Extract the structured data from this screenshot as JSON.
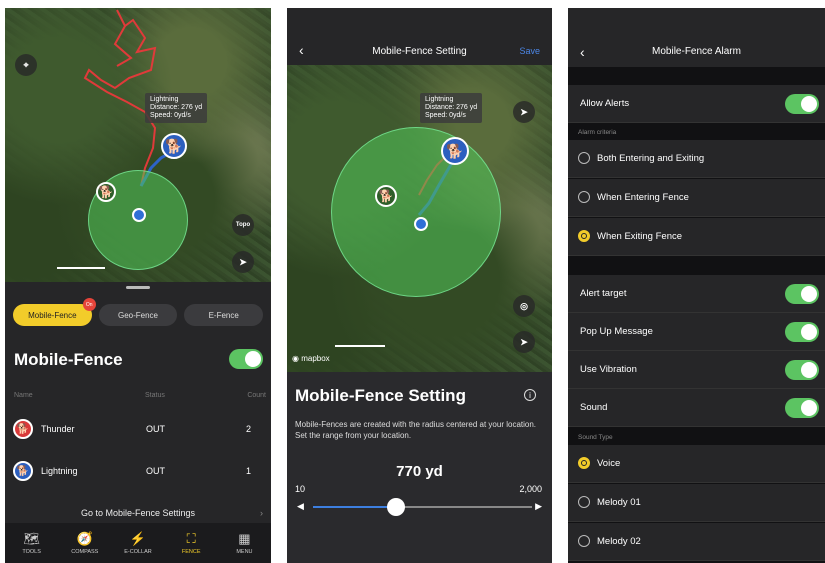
{
  "panel1": {
    "tooltip": {
      "name": "Lightning",
      "distance": "Distance: 276 yd",
      "speed": "Speed: 0yd/s"
    },
    "topo_label": "Topo",
    "segments": [
      {
        "label": "Mobile-Fence",
        "badge": "On",
        "active": true
      },
      {
        "label": "Geo-Fence",
        "active": false
      },
      {
        "label": "E-Fence",
        "active": false
      }
    ],
    "title": "Mobile-Fence",
    "toggle_on": true,
    "columns": {
      "name": "Name",
      "status": "Status",
      "count": "Count"
    },
    "rows": [
      {
        "name": "Thunder",
        "status": "OUT",
        "count": "2",
        "color": "#d93a3a"
      },
      {
        "name": "Lightning",
        "status": "OUT",
        "count": "1",
        "color": "#2c5fbf"
      }
    ],
    "goto_link": "Go to Mobile-Fence Settings",
    "tabs": [
      {
        "label": "TOOLS",
        "icon": "map-icon",
        "glyph": "🗺",
        "active": false
      },
      {
        "label": "COMPASS",
        "icon": "compass-icon",
        "glyph": "🧭",
        "active": false
      },
      {
        "label": "E-COLLAR",
        "icon": "collar-icon",
        "glyph": "⚡",
        "active": false
      },
      {
        "label": "FENCE",
        "icon": "fence-icon",
        "glyph": "⛶",
        "active": true
      },
      {
        "label": "MENU",
        "icon": "menu-grid-icon",
        "glyph": "▦",
        "active": false
      }
    ],
    "accent": "#f2cc2a"
  },
  "panel2": {
    "nav_title": "Mobile-Fence Setting",
    "back": "‹",
    "save": "Save",
    "tooltip": {
      "name": "Lightning",
      "distance": "Distance: 276 yd",
      "speed": "Speed: 0yd/s"
    },
    "mapbox": "mapbox",
    "card_title": "Mobile-Fence Setting",
    "info": "i",
    "description": "Mobile-Fences are created with the radius centered at your location. Set the range from your location.",
    "range_value": "770 yd",
    "range_min": "10",
    "range_max": "2,000",
    "slider_fraction": 0.38,
    "link_color": "#4c86e6"
  },
  "panel3": {
    "nav_title": "Mobile-Fence Alarm",
    "back": "‹",
    "allow_alerts": "Allow Alerts",
    "alarm_criteria": "Alarm criteria",
    "criteria": [
      {
        "label": "Both Entering and Exiting",
        "selected": false
      },
      {
        "label": "When Entering Fence",
        "selected": false
      },
      {
        "label": "When Exiting Fence",
        "selected": true
      }
    ],
    "toggles": [
      {
        "label": "Alert target",
        "on": true
      },
      {
        "label": "Pop Up Message",
        "on": true
      },
      {
        "label": "Use Vibration",
        "on": true
      },
      {
        "label": "Sound",
        "on": true
      }
    ],
    "sound_type": "Sound Type",
    "sounds": [
      {
        "label": "Voice",
        "selected": true
      },
      {
        "label": "Melody 01",
        "selected": false
      },
      {
        "label": "Melody 02",
        "selected": false
      }
    ],
    "toggle_color": "#5cc462"
  }
}
